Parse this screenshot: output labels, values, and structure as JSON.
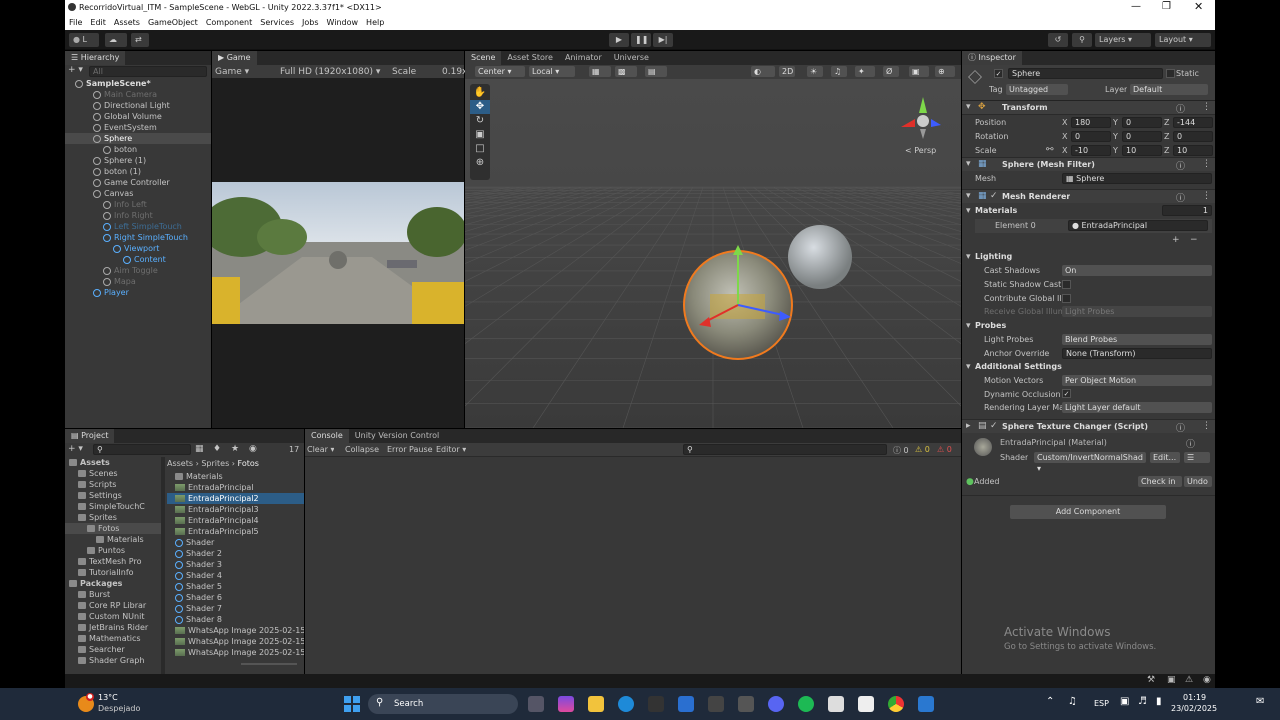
{
  "window": {
    "title": "RecorridoVirtual_ITM - SampleScene - WebGL - Unity 2022.3.37f1* <DX11>",
    "menu": [
      "File",
      "Edit",
      "Assets",
      "GameObject",
      "Component",
      "Services",
      "Jobs",
      "Window",
      "Help"
    ]
  },
  "toolbar": {
    "account": "L",
    "layers_label": "Layers",
    "layout_label": "Layout"
  },
  "hierarchy": {
    "tab": "Hierarchy",
    "search_placeholder": "All",
    "scene": "SampleScene*",
    "items": [
      {
        "label": "Main Camera",
        "depth": 1,
        "state": "dim"
      },
      {
        "label": "Directional Light",
        "depth": 1,
        "state": "normal"
      },
      {
        "label": "Global Volume",
        "depth": 1,
        "state": "normal"
      },
      {
        "label": "EventSystem",
        "depth": 1,
        "state": "normal"
      },
      {
        "label": "Sphere",
        "depth": 1,
        "state": "selected"
      },
      {
        "label": "boton",
        "depth": 2,
        "state": "normal"
      },
      {
        "label": "Sphere (1)",
        "depth": 1,
        "state": "normal"
      },
      {
        "label": "boton (1)",
        "depth": 1,
        "state": "normal"
      },
      {
        "label": "Game Controller",
        "depth": 1,
        "state": "normal"
      },
      {
        "label": "Canvas",
        "depth": 1,
        "state": "normal"
      },
      {
        "label": "Info Left",
        "depth": 2,
        "state": "dim"
      },
      {
        "label": "Info Right",
        "depth": 2,
        "state": "dim"
      },
      {
        "label": "Left SimpleTouch",
        "depth": 2,
        "state": "dimblue"
      },
      {
        "label": "Right SimpleTouch",
        "depth": 2,
        "state": "blue"
      },
      {
        "label": "Viewport",
        "depth": 3,
        "state": "blue"
      },
      {
        "label": "Content",
        "depth": 4,
        "state": "blue"
      },
      {
        "label": "Aim Toggle",
        "depth": 2,
        "state": "dim"
      },
      {
        "label": "Mapa",
        "depth": 2,
        "state": "dim"
      },
      {
        "label": "Player",
        "depth": 1,
        "state": "blue"
      }
    ]
  },
  "game": {
    "tab": "Game",
    "display": "Game",
    "resolution": "Full HD (1920x1080)",
    "scale_label": "Scale",
    "scale_value": "0.19x"
  },
  "scene": {
    "tabs": [
      "Scene",
      "Asset Store",
      "Animator",
      "Universe"
    ],
    "pivot": "Center",
    "space": "Local",
    "mode_2d": "2D",
    "persp": "Persp"
  },
  "inspector": {
    "tab": "Inspector",
    "object_name": "Sphere",
    "static_label": "Static",
    "tag_label": "Tag",
    "tag": "Untagged",
    "layer_label": "Layer",
    "layer": "Default",
    "transform": {
      "title": "Transform",
      "position": {
        "label": "Position",
        "x": "180",
        "y": "0",
        "z": "-144"
      },
      "rotation": {
        "label": "Rotation",
        "x": "0",
        "y": "0",
        "z": "0"
      },
      "scale": {
        "label": "Scale",
        "x": "-10",
        "y": "10",
        "z": "10"
      }
    },
    "mesh_filter": {
      "title": "Sphere (Mesh Filter)",
      "mesh_label": "Mesh",
      "mesh": "Sphere"
    },
    "mesh_renderer": {
      "title": "Mesh Renderer",
      "materials_label": "Materials",
      "materials_count": "1",
      "element_label": "Element 0",
      "element_value": "EntradaPrincipal",
      "lighting_label": "Lighting",
      "cast_shadows_label": "Cast Shadows",
      "cast_shadows": "On",
      "static_shadow_label": "Static Shadow Cast",
      "contribute_gi_label": "Contribute Global Ill",
      "receive_gi_label": "Receive Global Illum",
      "receive_gi": "Light Probes",
      "probes_label": "Probes",
      "light_probes_label": "Light Probes",
      "light_probes": "Blend Probes",
      "anchor_label": "Anchor Override",
      "anchor": "None (Transform)",
      "additional_label": "Additional Settings",
      "motion_label": "Motion Vectors",
      "motion": "Per Object Motion",
      "dynamic_label": "Dynamic Occlusion",
      "rendering_layer_label": "Rendering Layer Ma",
      "rendering_layer": "Light Layer default"
    },
    "script": {
      "title": "Sphere Texture Changer (Script)"
    },
    "material": {
      "name": "EntradaPrincipal (Material)",
      "shader_label": "Shader",
      "shader": "Custom/InvertNormalShad",
      "edit": "Edit...",
      "added": "Added",
      "checkin": "Check in",
      "undo": "Undo"
    },
    "add_component": "Add Component"
  },
  "project": {
    "tab": "Project",
    "count": "17",
    "breadcrumb": [
      "Assets",
      "Sprites",
      "Fotos"
    ],
    "tree": [
      {
        "label": "Assets",
        "depth": 0,
        "bold": true
      },
      {
        "label": "Scenes",
        "depth": 1
      },
      {
        "label": "Scripts",
        "depth": 1
      },
      {
        "label": "Settings",
        "depth": 1
      },
      {
        "label": "SimpleTouchC",
        "depth": 1
      },
      {
        "label": "Sprites",
        "depth": 1
      },
      {
        "label": "Fotos",
        "depth": 2,
        "selected": true
      },
      {
        "label": "Materials",
        "depth": 3
      },
      {
        "label": "Puntos",
        "depth": 2
      },
      {
        "label": "TextMesh Pro",
        "depth": 1
      },
      {
        "label": "TutorialInfo",
        "depth": 1
      },
      {
        "label": "Packages",
        "depth": 0,
        "bold": true
      },
      {
        "label": "Burst",
        "depth": 1
      },
      {
        "label": "Core RP Librar",
        "depth": 1
      },
      {
        "label": "Custom NUnit",
        "depth": 1
      },
      {
        "label": "JetBrains Rider",
        "depth": 1
      },
      {
        "label": "Mathematics",
        "depth": 1
      },
      {
        "label": "Searcher",
        "depth": 1
      },
      {
        "label": "Shader Graph",
        "depth": 1
      }
    ],
    "files": [
      {
        "label": "Materials",
        "kind": "folder"
      },
      {
        "label": "EntradaPrincipal",
        "kind": "image"
      },
      {
        "label": "EntradaPrincipal2",
        "kind": "image",
        "selected": true
      },
      {
        "label": "EntradaPrincipal3",
        "kind": "image"
      },
      {
        "label": "EntradaPrincipal4",
        "kind": "image"
      },
      {
        "label": "EntradaPrincipal5",
        "kind": "image"
      },
      {
        "label": "Shader",
        "kind": "shader"
      },
      {
        "label": "Shader 2",
        "kind": "shader"
      },
      {
        "label": "Shader 3",
        "kind": "shader"
      },
      {
        "label": "Shader 4",
        "kind": "shader"
      },
      {
        "label": "Shader 5",
        "kind": "shader"
      },
      {
        "label": "Shader 6",
        "kind": "shader"
      },
      {
        "label": "Shader 7",
        "kind": "shader"
      },
      {
        "label": "Shader 8",
        "kind": "shader"
      },
      {
        "label": "WhatsApp Image 2025-02-15",
        "kind": "image"
      },
      {
        "label": "WhatsApp Image 2025-02-15",
        "kind": "image"
      },
      {
        "label": "WhatsApp Image 2025-02-15",
        "kind": "image"
      }
    ]
  },
  "console": {
    "tabs": [
      "Console",
      "Unity Version Control"
    ],
    "clear": "Clear",
    "collapse": "Collapse",
    "error_pause": "Error Pause",
    "editor": "Editor",
    "count_warn": "0",
    "count_err": "0",
    "count_info": "0"
  },
  "watermark": {
    "line1": "Activate Windows",
    "line2": "Go to Settings to activate Windows."
  },
  "taskbar": {
    "temp": "13°C",
    "weather": "Despejado",
    "search": "Search",
    "lang": "ESP",
    "time": "01:19",
    "date": "23/02/2025"
  }
}
